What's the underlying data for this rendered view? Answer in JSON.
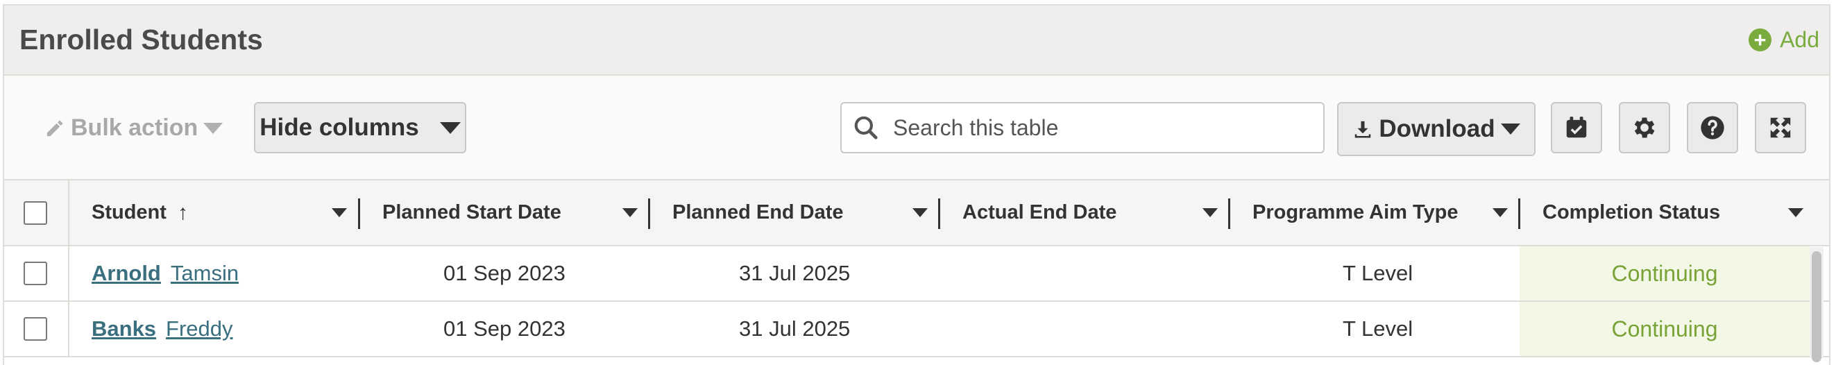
{
  "panel": {
    "title": "Enrolled Students",
    "add_label": "Add"
  },
  "toolbar": {
    "bulk_action_label": "Bulk action",
    "hide_columns_label": "Hide columns",
    "search_placeholder": "Search this table",
    "download_label": "Download"
  },
  "table": {
    "columns": [
      {
        "label": "Student",
        "sort": "ascending"
      },
      {
        "label": "Planned Start Date"
      },
      {
        "label": "Planned End Date"
      },
      {
        "label": "Actual End Date"
      },
      {
        "label": "Programme Aim Type"
      },
      {
        "label": "Completion Status"
      }
    ],
    "rows": [
      {
        "surname": "Arnold",
        "forename": "Tamsin",
        "planned_start": "01 Sep 2023",
        "planned_end": "31 Jul 2025",
        "actual_end": "",
        "aim_type": "T Level",
        "status": "Continuing"
      },
      {
        "surname": "Banks",
        "forename": "Freddy",
        "planned_start": "01 Sep 2023",
        "planned_end": "31 Jul 2025",
        "actual_end": "",
        "aim_type": "T Level",
        "status": "Continuing"
      }
    ]
  },
  "colors": {
    "accent_green": "#7aab3e",
    "link_teal": "#3a6f7f",
    "status_bg": "#f2f7e6"
  },
  "icons": [
    "plus-circle-icon",
    "pencil-icon",
    "caret-down-icon",
    "search-icon",
    "download-icon",
    "calendar-check-icon",
    "gear-icon",
    "question-circle-icon",
    "expand-icon",
    "sort-ascending-icon"
  ]
}
